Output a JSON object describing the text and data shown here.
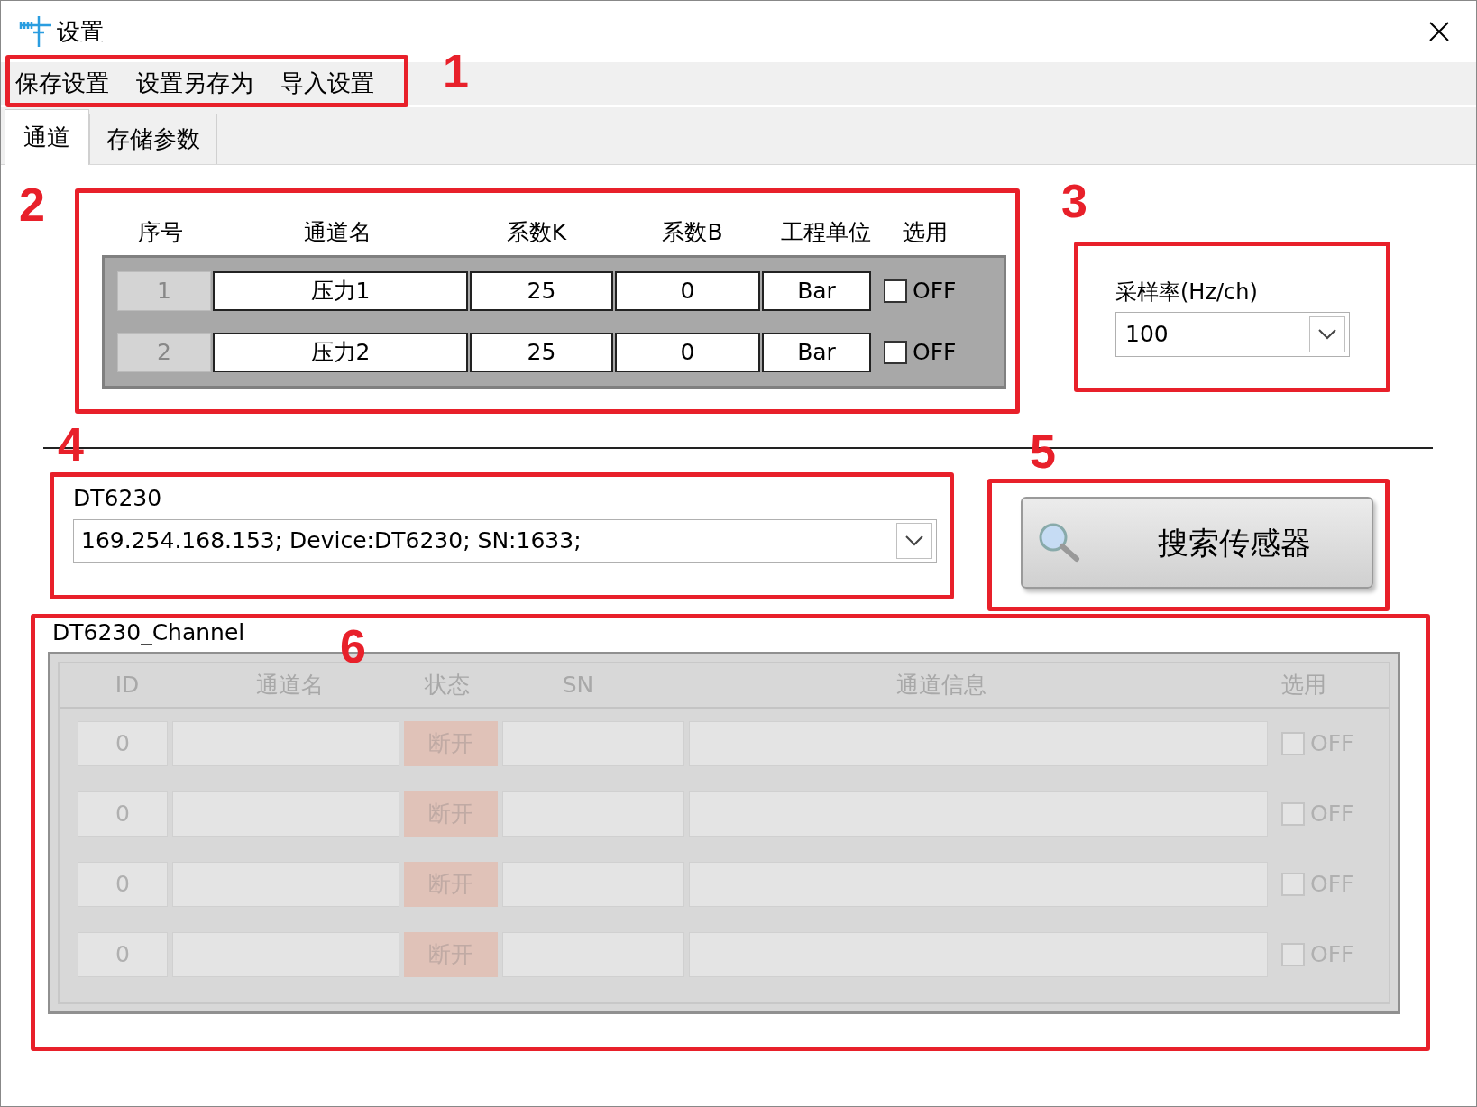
{
  "window": {
    "title": "设置"
  },
  "menu": [
    "保存设置",
    "设置另存为",
    "导入设置"
  ],
  "tabs": [
    {
      "label": "通道",
      "selected": true
    },
    {
      "label": "存储参数",
      "selected": false
    }
  ],
  "channel_table": {
    "columns": [
      "序号",
      "通道名",
      "系数K",
      "系数B",
      "工程单位",
      "选用"
    ],
    "rows": [
      {
        "index": "1",
        "name": "压力1",
        "k": "25",
        "b": "0",
        "unit": "Bar",
        "checked": false,
        "check_label": "OFF"
      },
      {
        "index": "2",
        "name": "压力2",
        "k": "25",
        "b": "0",
        "unit": "Bar",
        "checked": false,
        "check_label": "OFF"
      }
    ]
  },
  "sample_rate": {
    "label": "采样率(Hz/ch)",
    "value": "100"
  },
  "device": {
    "label": "DT6230",
    "value": "169.254.168.153; Device:DT6230; SN:1633;"
  },
  "search_button": {
    "label": "搜索传感器"
  },
  "sensor_channels": {
    "title": "DT6230_Channel",
    "disabled": true,
    "columns": [
      "ID",
      "通道名",
      "状态",
      "SN",
      "通道信息",
      "选用"
    ],
    "rows": [
      {
        "id": "0",
        "status": "断开",
        "checked": false,
        "check_label": "OFF"
      },
      {
        "id": "0",
        "status": "断开",
        "checked": false,
        "check_label": "OFF"
      },
      {
        "id": "0",
        "status": "断开",
        "checked": false,
        "check_label": "OFF"
      },
      {
        "id": "0",
        "status": "断开",
        "checked": false,
        "check_label": "OFF"
      }
    ]
  },
  "annotations": [
    {
      "label": "1"
    },
    {
      "label": "2"
    },
    {
      "label": "3"
    },
    {
      "label": "4"
    },
    {
      "label": "5"
    },
    {
      "label": "6"
    }
  ]
}
